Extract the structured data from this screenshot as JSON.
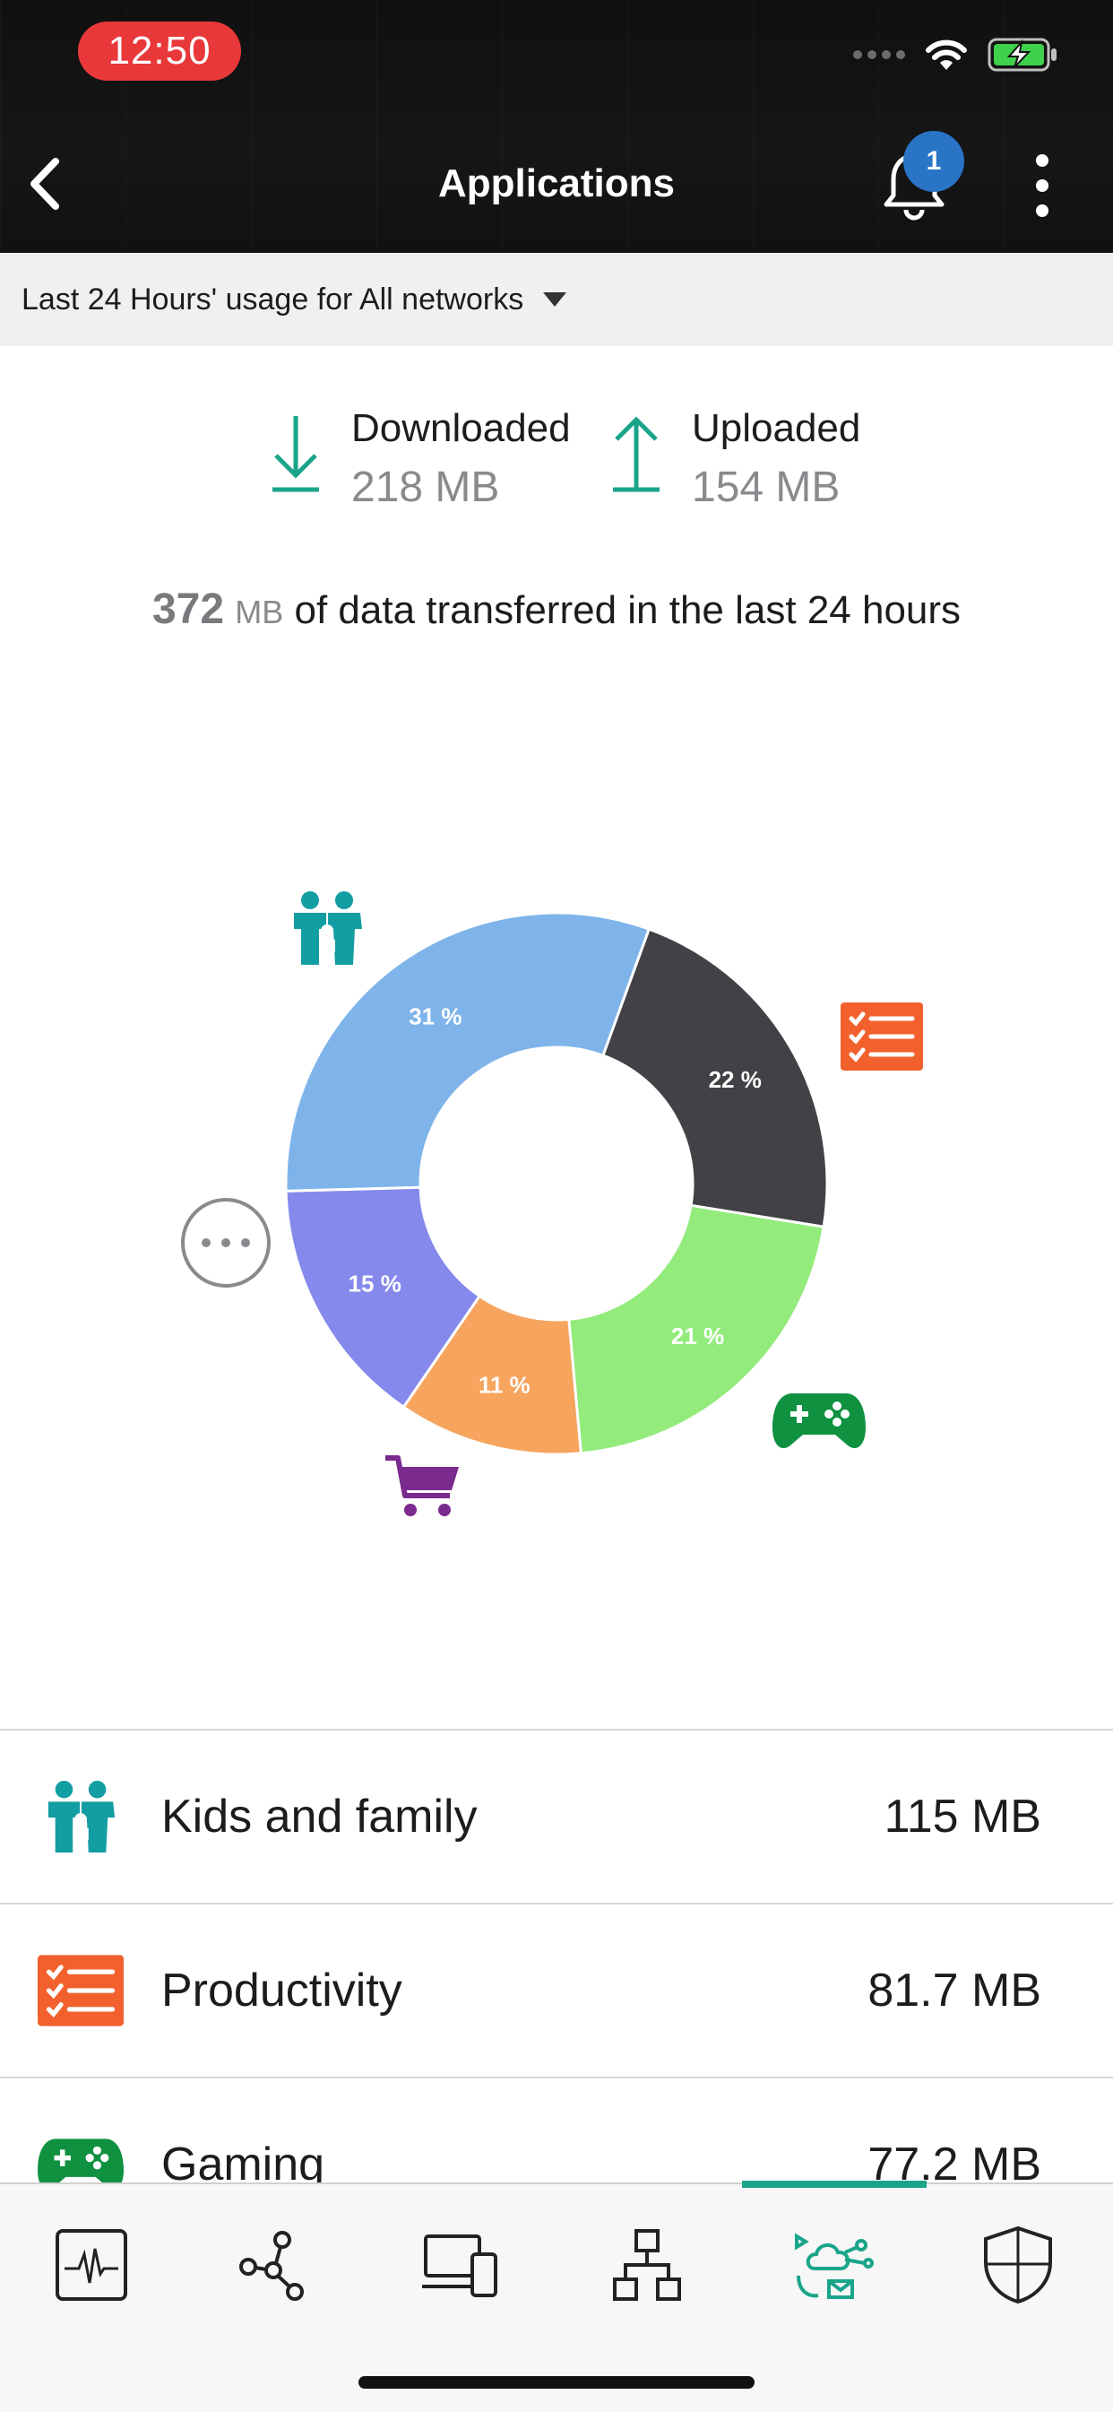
{
  "status_bar": {
    "time": "12:50"
  },
  "header": {
    "title": "Applications",
    "notification_count": "1"
  },
  "filter": {
    "label": "Last 24 Hours' usage for All networks"
  },
  "summary": {
    "downloaded_label": "Downloaded",
    "downloaded_value": "218 MB",
    "uploaded_label": "Uploaded",
    "uploaded_value": "154 MB",
    "total_number": "372",
    "total_unit": "MB",
    "total_text": "of data transferred in the last 24 hours"
  },
  "chart_data": {
    "type": "pie",
    "values": [
      31,
      22,
      21,
      11,
      15
    ],
    "labels": [
      "31 %",
      "22 %",
      "21 %",
      "11 %",
      "15 %"
    ],
    "colors": [
      "#7fb4ea",
      "#414146",
      "#93eb7c",
      "#f6a45e",
      "#8589ec"
    ],
    "icons": [
      "kids-and-family-icon",
      "productivity-icon",
      "gaming-icon",
      "shopping-cart-icon",
      "more-icon"
    ]
  },
  "categories": [
    {
      "name": "Kids and family",
      "value": "115 MB",
      "icon": "kids-and-family-icon",
      "color": "#139ea3"
    },
    {
      "name": "Productivity",
      "value": "81.7 MB",
      "icon": "productivity-icon",
      "color": "#f2612d"
    },
    {
      "name": "Gaming",
      "value": "77.2 MB",
      "icon": "gaming-icon",
      "color": "#0f9140"
    }
  ],
  "colors": {
    "accent": "#1aa58a",
    "badge": "#2a74c6",
    "time_pill": "#e8383a",
    "shopping": "#7b2a8e"
  },
  "tabbar": {
    "tabs": [
      "activity-icon",
      "network-topology-icon",
      "devices-icon",
      "hierarchy-icon",
      "applications-icon",
      "security-shield-icon"
    ],
    "active_index": 4
  }
}
